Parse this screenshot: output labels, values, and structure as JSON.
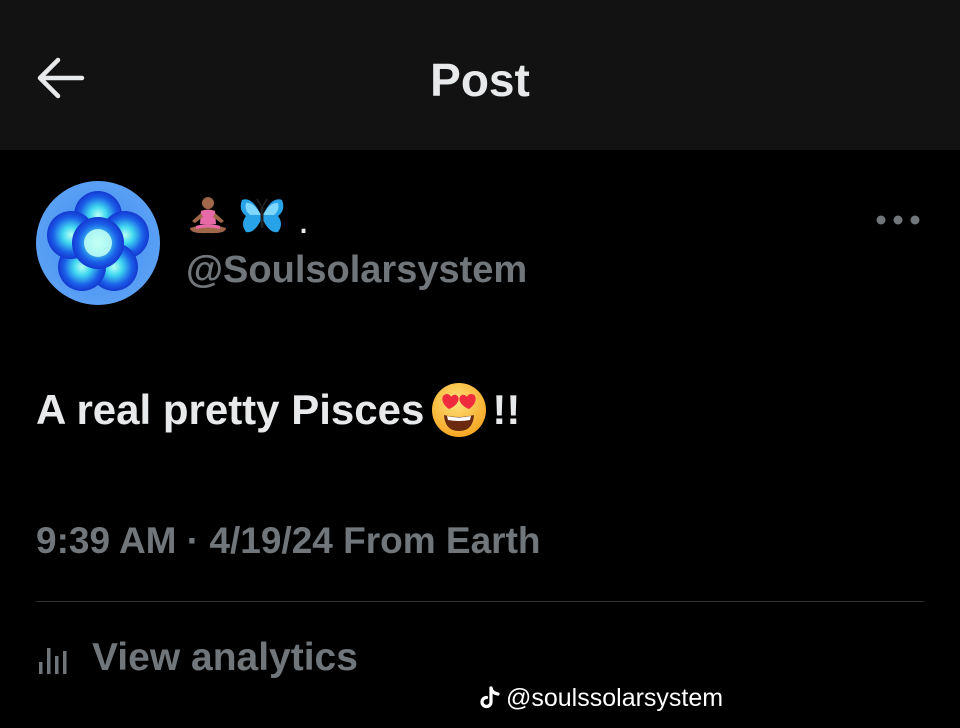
{
  "header": {
    "title": "Post",
    "back_icon": "arrow-left-icon"
  },
  "author": {
    "avatar_icon": "blue-flower-avatar",
    "display_name_emojis": [
      "person-meditating-emoji",
      "butterfly-emoji"
    ],
    "display_name_suffix": ".",
    "handle": "@Soulsolarsystem",
    "more_icon": "more-horizontal-icon"
  },
  "post": {
    "text_before_emoji": "A real pretty Pisces",
    "emoji": "heart-eyes-emoji",
    "text_after_emoji": "!!"
  },
  "meta": {
    "time": "9:39 AM",
    "separator": "·",
    "date": "4/19/24",
    "source": "From Earth"
  },
  "analytics": {
    "icon": "analytics-icon",
    "label": "View analytics"
  },
  "watermark": {
    "icon": "tiktok-icon",
    "text": "@soulssolarsystem"
  },
  "colors": {
    "background": "#000000",
    "header_background": "#121212",
    "primary_text": "#e7e9ea",
    "secondary_text": "#71767b",
    "divider": "#2f3336"
  }
}
